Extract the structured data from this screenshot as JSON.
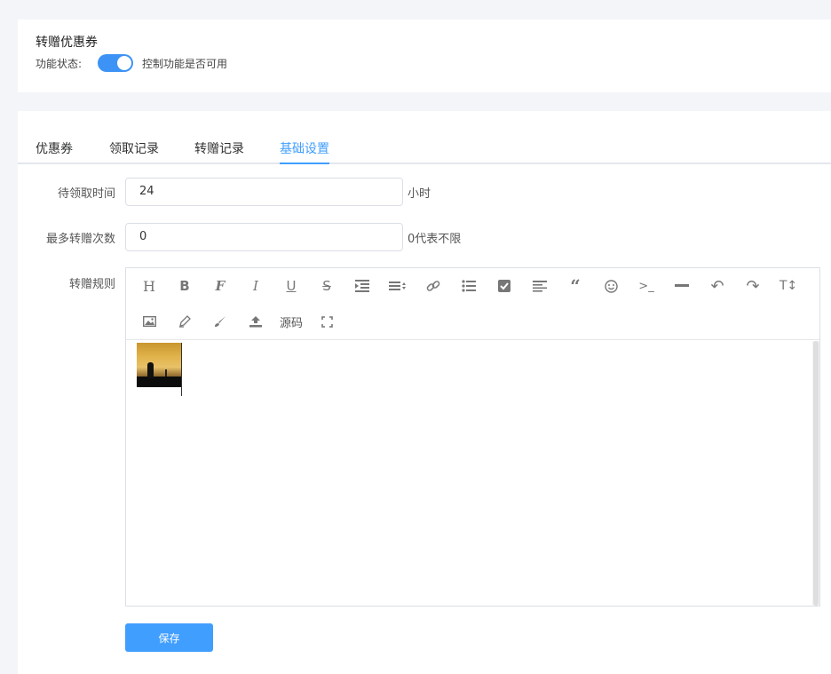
{
  "feature": {
    "title": "转赠优惠券",
    "status_label": "功能状态:",
    "enabled": true,
    "status_hint": "控制功能是否可用"
  },
  "tabs": [
    {
      "label": "优惠券",
      "active": false
    },
    {
      "label": "领取记录",
      "active": false
    },
    {
      "label": "转赠记录",
      "active": false
    },
    {
      "label": "基础设置",
      "active": true
    }
  ],
  "form": {
    "pickup_time": {
      "label": "待领取时间",
      "value": "24",
      "suffix": "小时"
    },
    "max_transfers": {
      "label": "最多转赠次数",
      "value": "0",
      "suffix": "0代表不限"
    },
    "rules": {
      "label": "转赠规则"
    }
  },
  "editor": {
    "toolbar_row1": [
      "heading-icon",
      "bold-icon",
      "font-icon",
      "italic-icon",
      "underline-icon",
      "strikethrough-icon",
      "indent-icon",
      "line-height-icon",
      "link-icon",
      "list-icon",
      "checkbox-icon",
      "align-left-icon",
      "quote-icon",
      "emoji-icon",
      "code-icon",
      "divider-icon",
      "undo-icon",
      "redo-icon",
      "text-size-icon"
    ],
    "toolbar_row2": [
      "image-icon",
      "pen-icon",
      "brush-icon",
      "upload-icon",
      "source-code-button",
      "fullscreen-icon"
    ],
    "source_label": "源码"
  },
  "save_label": "保存",
  "colors": {
    "accent": "#409eff",
    "switch_on": "#3c93f5"
  }
}
